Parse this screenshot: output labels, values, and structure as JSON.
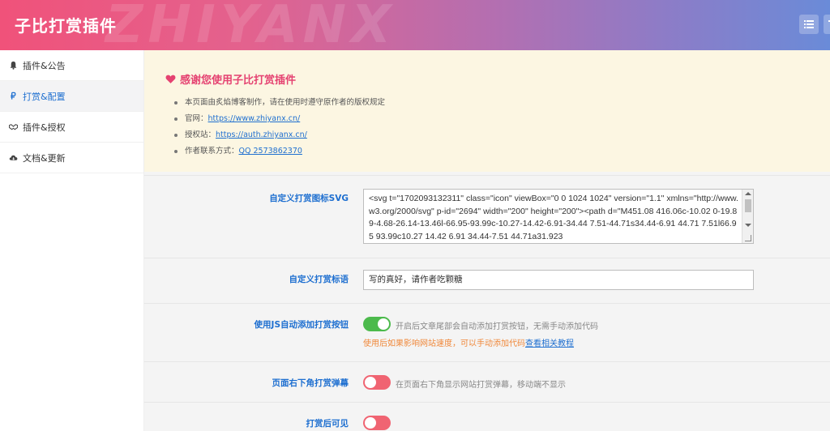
{
  "header": {
    "title": "子比打赏插件",
    "watermark": "ZHIYANX",
    "accent": "#f0527a"
  },
  "sidebar": {
    "items": [
      {
        "label": "插件&公告",
        "icon": "bell-icon"
      },
      {
        "label": "打赏&配置",
        "icon": "ruble-icon",
        "active": true
      },
      {
        "label": "插件&授权",
        "icon": "handshake-icon"
      },
      {
        "label": "文档&更新",
        "icon": "cloud-download-icon"
      }
    ]
  },
  "notice": {
    "title": "感谢您使用子比打赏插件",
    "line1": "本页面由炙焰博客制作，请在使用时遵守原作者的版权规定",
    "site_label": "官网：",
    "site_link": "https://www.zhiyanx.cn/",
    "auth_label": "授权站：",
    "auth_link": "https://auth.zhiyanx.cn/",
    "contact_label": "作者联系方式：",
    "contact_link": "QQ 2573862370"
  },
  "settings": {
    "svg_label": "自定义打赏图标SVG",
    "svg_value": "<svg t=\"1702093132311\" class=\"icon\" viewBox=\"0 0 1024 1024\" version=\"1.1\" xmlns=\"http://www.w3.org/2000/svg\" p-id=\"2694\" width=\"200\" height=\"200\"><path d=\"M451.08 416.06c-10.02 0-19.89-4.68-26.14-13.46l-66.95-93.99c-10.27-14.42-6.91-34.44 7.51-44.71s34.44-6.91 44.71 7.51l66.95 93.99c10.27 14.42 6.91 34.44-7.51 44.71a31.923",
    "slogan_label": "自定义打赏标语",
    "slogan_value": "写的真好，请作者吃颗糖",
    "js_label": "使用JS自动添加打赏按钮",
    "js_hint": "开启后文章尾部会自动添加打赏按钮，无需手动添加代码",
    "js_warn": "使用后如果影响网站速度，可以手动添加代码",
    "js_warn_link": "查看相关教程",
    "popup_label": "页面右下角打赏弹幕",
    "popup_hint": "在页面右下角显示网站打赏弹幕，移动端不显示",
    "after_label": "打赏后可见"
  }
}
